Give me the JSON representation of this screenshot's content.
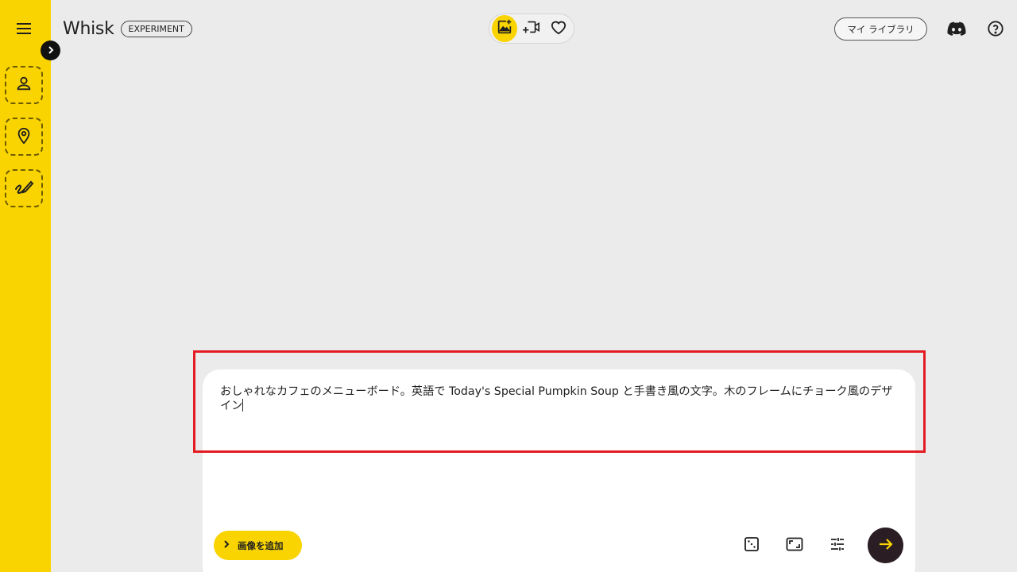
{
  "app": {
    "title": "Whisk",
    "badge": "EXPERIMENT"
  },
  "colors": {
    "accent": "#fad400",
    "background": "#ebebeb",
    "send_button": "#2a1d24",
    "highlight": "#e31b23"
  },
  "sidebar": {
    "menu_icon": "hamburger-menu-icon",
    "expand_icon": "chevron-right-icon",
    "slots": [
      {
        "name": "subject",
        "icon": "person-icon"
      },
      {
        "name": "scene",
        "icon": "location-pin-icon"
      },
      {
        "name": "style",
        "icon": "brush-stroke-icon"
      }
    ]
  },
  "mode_switch": {
    "items": [
      {
        "name": "image",
        "icon": "image-sparkle-icon",
        "active": true
      },
      {
        "name": "video",
        "icon": "video-sparkle-icon",
        "active": false
      },
      {
        "name": "favorites",
        "icon": "heart-icon",
        "active": false
      }
    ]
  },
  "header": {
    "library_label": "マイ ライブラリ",
    "discord_icon": "discord-icon",
    "help_icon": "help-circle-icon"
  },
  "prompt": {
    "value": "おしゃれなカフェのメニューボード。英語で Today's Special Pumpkin Soup と手書き風の文字。木のフレームにチョーク風のデザイン"
  },
  "toolbar": {
    "add_image_label": "画像を追加",
    "tools": [
      {
        "name": "randomize",
        "icon": "dice-icon"
      },
      {
        "name": "aspect-ratio",
        "icon": "aspect-ratio-icon"
      },
      {
        "name": "settings",
        "icon": "sliders-icon"
      }
    ],
    "send_icon": "arrow-right-icon"
  }
}
